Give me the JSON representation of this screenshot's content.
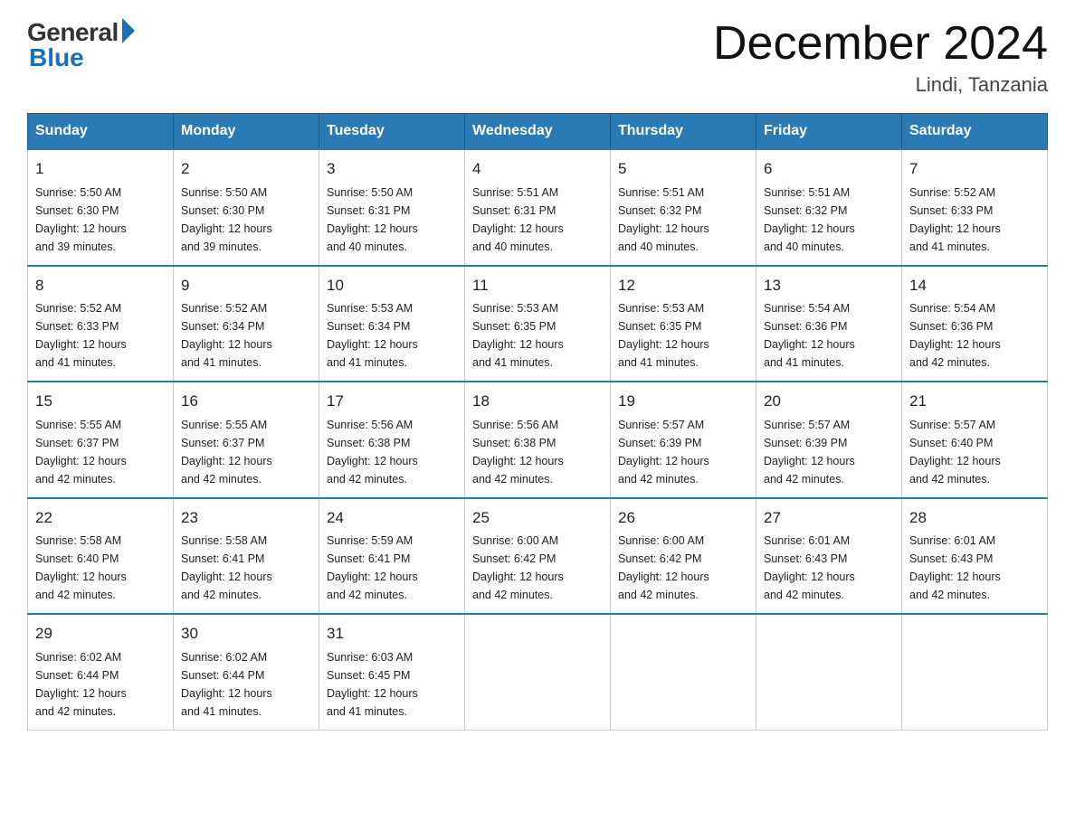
{
  "header": {
    "logo_general": "General",
    "logo_blue": "Blue",
    "title": "December 2024",
    "location": "Lindi, Tanzania"
  },
  "days_of_week": [
    "Sunday",
    "Monday",
    "Tuesday",
    "Wednesday",
    "Thursday",
    "Friday",
    "Saturday"
  ],
  "weeks": [
    [
      {
        "day": "1",
        "sunrise": "5:50 AM",
        "sunset": "6:30 PM",
        "daylight": "12 hours and 39 minutes."
      },
      {
        "day": "2",
        "sunrise": "5:50 AM",
        "sunset": "6:30 PM",
        "daylight": "12 hours and 39 minutes."
      },
      {
        "day": "3",
        "sunrise": "5:50 AM",
        "sunset": "6:31 PM",
        "daylight": "12 hours and 40 minutes."
      },
      {
        "day": "4",
        "sunrise": "5:51 AM",
        "sunset": "6:31 PM",
        "daylight": "12 hours and 40 minutes."
      },
      {
        "day": "5",
        "sunrise": "5:51 AM",
        "sunset": "6:32 PM",
        "daylight": "12 hours and 40 minutes."
      },
      {
        "day": "6",
        "sunrise": "5:51 AM",
        "sunset": "6:32 PM",
        "daylight": "12 hours and 40 minutes."
      },
      {
        "day": "7",
        "sunrise": "5:52 AM",
        "sunset": "6:33 PM",
        "daylight": "12 hours and 41 minutes."
      }
    ],
    [
      {
        "day": "8",
        "sunrise": "5:52 AM",
        "sunset": "6:33 PM",
        "daylight": "12 hours and 41 minutes."
      },
      {
        "day": "9",
        "sunrise": "5:52 AM",
        "sunset": "6:34 PM",
        "daylight": "12 hours and 41 minutes."
      },
      {
        "day": "10",
        "sunrise": "5:53 AM",
        "sunset": "6:34 PM",
        "daylight": "12 hours and 41 minutes."
      },
      {
        "day": "11",
        "sunrise": "5:53 AM",
        "sunset": "6:35 PM",
        "daylight": "12 hours and 41 minutes."
      },
      {
        "day": "12",
        "sunrise": "5:53 AM",
        "sunset": "6:35 PM",
        "daylight": "12 hours and 41 minutes."
      },
      {
        "day": "13",
        "sunrise": "5:54 AM",
        "sunset": "6:36 PM",
        "daylight": "12 hours and 41 minutes."
      },
      {
        "day": "14",
        "sunrise": "5:54 AM",
        "sunset": "6:36 PM",
        "daylight": "12 hours and 42 minutes."
      }
    ],
    [
      {
        "day": "15",
        "sunrise": "5:55 AM",
        "sunset": "6:37 PM",
        "daylight": "12 hours and 42 minutes."
      },
      {
        "day": "16",
        "sunrise": "5:55 AM",
        "sunset": "6:37 PM",
        "daylight": "12 hours and 42 minutes."
      },
      {
        "day": "17",
        "sunrise": "5:56 AM",
        "sunset": "6:38 PM",
        "daylight": "12 hours and 42 minutes."
      },
      {
        "day": "18",
        "sunrise": "5:56 AM",
        "sunset": "6:38 PM",
        "daylight": "12 hours and 42 minutes."
      },
      {
        "day": "19",
        "sunrise": "5:57 AM",
        "sunset": "6:39 PM",
        "daylight": "12 hours and 42 minutes."
      },
      {
        "day": "20",
        "sunrise": "5:57 AM",
        "sunset": "6:39 PM",
        "daylight": "12 hours and 42 minutes."
      },
      {
        "day": "21",
        "sunrise": "5:57 AM",
        "sunset": "6:40 PM",
        "daylight": "12 hours and 42 minutes."
      }
    ],
    [
      {
        "day": "22",
        "sunrise": "5:58 AM",
        "sunset": "6:40 PM",
        "daylight": "12 hours and 42 minutes."
      },
      {
        "day": "23",
        "sunrise": "5:58 AM",
        "sunset": "6:41 PM",
        "daylight": "12 hours and 42 minutes."
      },
      {
        "day": "24",
        "sunrise": "5:59 AM",
        "sunset": "6:41 PM",
        "daylight": "12 hours and 42 minutes."
      },
      {
        "day": "25",
        "sunrise": "6:00 AM",
        "sunset": "6:42 PM",
        "daylight": "12 hours and 42 minutes."
      },
      {
        "day": "26",
        "sunrise": "6:00 AM",
        "sunset": "6:42 PM",
        "daylight": "12 hours and 42 minutes."
      },
      {
        "day": "27",
        "sunrise": "6:01 AM",
        "sunset": "6:43 PM",
        "daylight": "12 hours and 42 minutes."
      },
      {
        "day": "28",
        "sunrise": "6:01 AM",
        "sunset": "6:43 PM",
        "daylight": "12 hours and 42 minutes."
      }
    ],
    [
      {
        "day": "29",
        "sunrise": "6:02 AM",
        "sunset": "6:44 PM",
        "daylight": "12 hours and 42 minutes."
      },
      {
        "day": "30",
        "sunrise": "6:02 AM",
        "sunset": "6:44 PM",
        "daylight": "12 hours and 41 minutes."
      },
      {
        "day": "31",
        "sunrise": "6:03 AM",
        "sunset": "6:45 PM",
        "daylight": "12 hours and 41 minutes."
      },
      null,
      null,
      null,
      null
    ]
  ]
}
